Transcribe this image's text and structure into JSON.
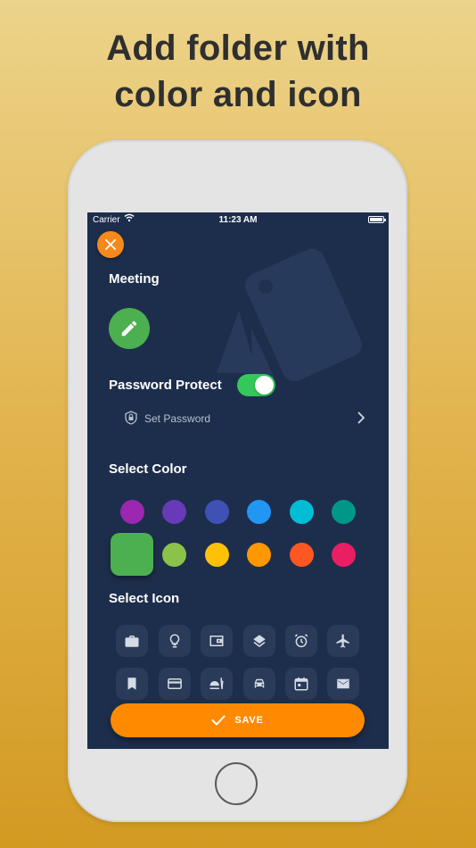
{
  "headline": {
    "line1": "Add folder with",
    "line2": "color and icon"
  },
  "status_bar": {
    "carrier": "Carrier",
    "time": "11:23 AM"
  },
  "form": {
    "folder_name": "Meeting",
    "password_protect_label": "Password Protect",
    "password_protect_on": true,
    "set_password_label": "Set Password",
    "select_color_label": "Select Color",
    "select_icon_label": "Select Icon",
    "save_label": "SAVE"
  },
  "colors": {
    "row1": [
      "#9c27b0",
      "#673ab7",
      "#3f51b5",
      "#2196f3",
      "#00bcd4",
      "#009688"
    ],
    "row2": [
      "#4caf50",
      "#8bc34a",
      "#ffc107",
      "#ff9800",
      "#ff5722",
      "#e91e63"
    ],
    "selected": "#4caf50",
    "accent": "#ff8a00",
    "background": "#1d2e4c"
  },
  "icons": {
    "row1": [
      "briefcase-icon",
      "lightbulb-icon",
      "wallet-icon",
      "layers-icon",
      "alarm-icon",
      "airplane-icon"
    ],
    "row2": [
      "bookmark-icon",
      "credit-card-icon",
      "restaurant-icon",
      "car-icon",
      "calendar-icon",
      "mail-icon"
    ],
    "preview": "pencil-icon"
  }
}
